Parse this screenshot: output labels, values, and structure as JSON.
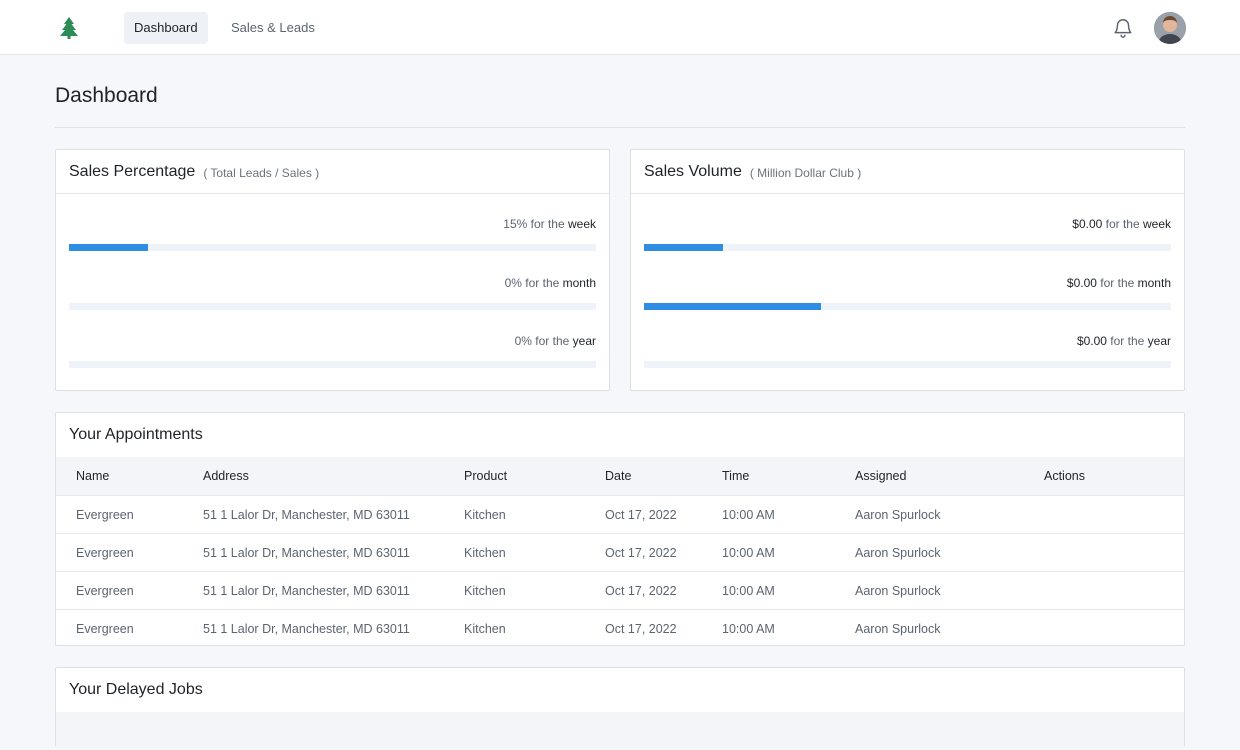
{
  "nav": {
    "items": [
      "Dashboard",
      "Sales & Leads"
    ],
    "active": "Dashboard"
  },
  "colors": {
    "accent": "#2f8de4",
    "logo": "#2e8b57",
    "track": "#eef3fa"
  },
  "page": {
    "title": "Dashboard"
  },
  "sales_percentage": {
    "title": "Sales Percentage",
    "subtitle": "( Total Leads / Sales )",
    "metrics": [
      {
        "value": "15%",
        "text": " for the ",
        "period": "week",
        "fill_percent": 15
      },
      {
        "value": "0%",
        "text": " for the ",
        "period": "month",
        "fill_percent": 0
      },
      {
        "value": "0%",
        "text": " for the ",
        "period": "year",
        "fill_percent": 0
      }
    ]
  },
  "sales_volume": {
    "title": "Sales Volume",
    "subtitle": "( Million Dollar Club )",
    "metrics": [
      {
        "value": "$0.00",
        "text": " for the ",
        "period": "week",
        "fill_percent": 15
      },
      {
        "value": "$0.00",
        "text": " for the ",
        "period": "month",
        "fill_percent": 33.6
      },
      {
        "value": "$0.00",
        "text": " for the ",
        "period": "year",
        "fill_percent": 0
      }
    ]
  },
  "appointments": {
    "title": "Your Appointments",
    "columns": [
      "Name",
      "Address",
      "Product",
      "Date",
      "Time",
      "Assigned",
      "Actions"
    ],
    "rows": [
      [
        "Evergreen",
        "51 1 Lalor Dr, Manchester, MD 63011",
        "Kitchen",
        "Oct 17, 2022",
        "10:00 AM",
        "Aaron Spurlock",
        ""
      ],
      [
        "Evergreen",
        "51 1 Lalor Dr, Manchester, MD 63011",
        "Kitchen",
        "Oct 17, 2022",
        "10:00 AM",
        "Aaron Spurlock",
        ""
      ],
      [
        "Evergreen",
        "51 1 Lalor Dr, Manchester, MD 63011",
        "Kitchen",
        "Oct 17, 2022",
        "10:00 AM",
        "Aaron Spurlock",
        ""
      ],
      [
        "Evergreen",
        "51 1 Lalor Dr, Manchester, MD 63011",
        "Kitchen",
        "Oct 17, 2022",
        "10:00 AM",
        "Aaron Spurlock",
        ""
      ]
    ]
  },
  "delayed_jobs": {
    "title": "Your Delayed Jobs"
  },
  "icons": {
    "logo": "pine-tree-icon",
    "notifications": "bell-icon",
    "avatar": "user-avatar"
  }
}
